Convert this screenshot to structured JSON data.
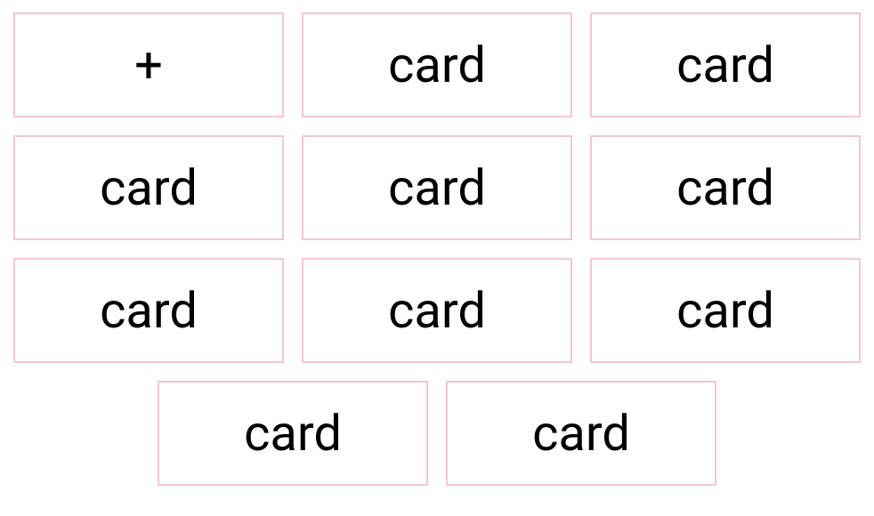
{
  "cards": [
    {
      "label": "+",
      "type": "add"
    },
    {
      "label": "card",
      "type": "item"
    },
    {
      "label": "card",
      "type": "item"
    },
    {
      "label": "card",
      "type": "item"
    },
    {
      "label": "card",
      "type": "item"
    },
    {
      "label": "card",
      "type": "item"
    },
    {
      "label": "card",
      "type": "item"
    },
    {
      "label": "card",
      "type": "item"
    },
    {
      "label": "card",
      "type": "item"
    },
    {
      "label": "card",
      "type": "item"
    },
    {
      "label": "card",
      "type": "item"
    }
  ]
}
